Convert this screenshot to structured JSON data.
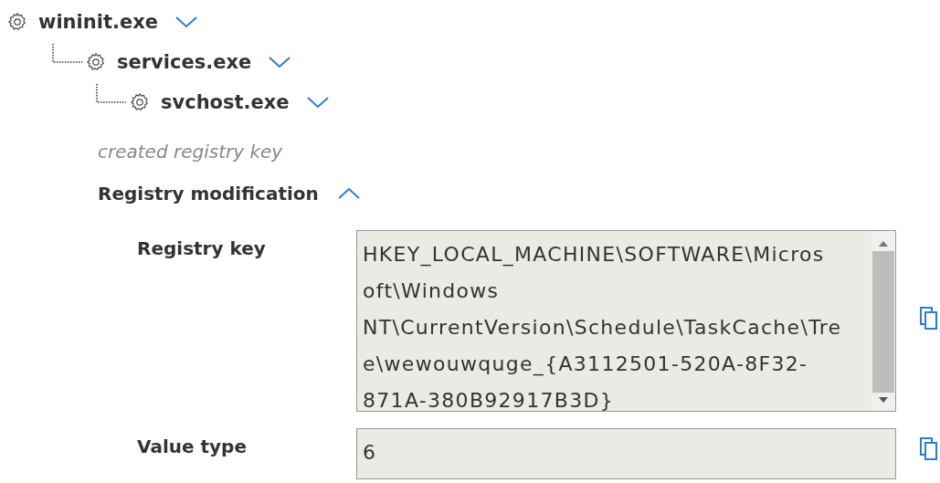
{
  "process_tree": [
    {
      "name": "wininit.exe",
      "children": [
        {
          "name": "services.exe",
          "children": [
            {
              "name": "svchost.exe"
            }
          ]
        }
      ]
    }
  ],
  "event": {
    "description": "created registry key",
    "section": {
      "title": "Registry modification",
      "expanded": true,
      "fields": [
        {
          "label": "Registry key",
          "value_lines": [
            "HKEY_LOCAL_MACHINE\\SOFTWARE\\Micros",
            "oft\\Windows",
            "NT\\CurrentVersion\\Schedule\\TaskCache\\Tre",
            "e\\wewouwquge_{A3112501-520A-8F32-",
            "871A-380B92917B3D}"
          ],
          "scrollable": true
        },
        {
          "label": "Value type",
          "value_lines": [
            "6"
          ],
          "scrollable": false
        }
      ]
    }
  }
}
